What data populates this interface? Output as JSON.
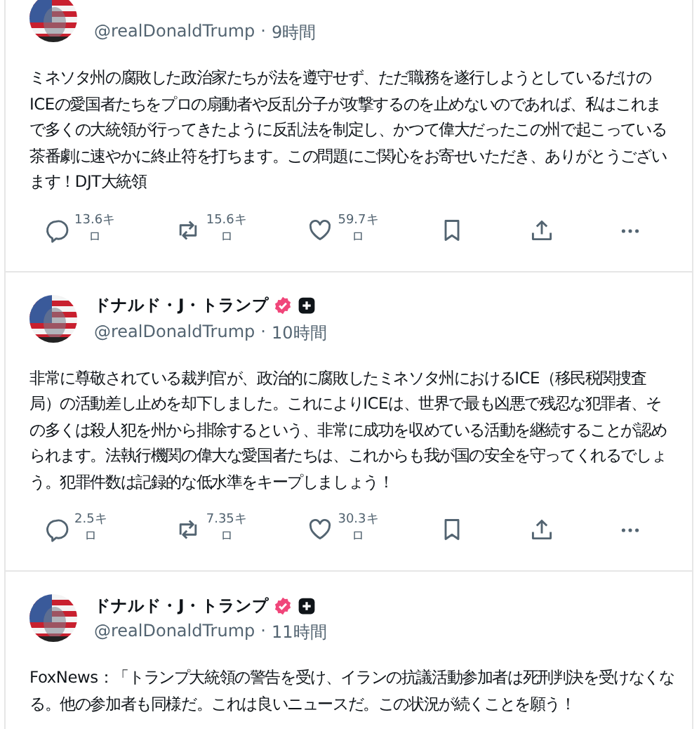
{
  "posts": [
    {
      "handle": "@realDonaldTrump",
      "separator": "·",
      "time": "9時間",
      "body": "ミネソタ州の腐敗した政治家たちが法を遵守せず、ただ職務を遂行しようとしているだけのICEの愛国者たちをプロの扇動者や反乱分子が攻撃するのを止めないのであれば、私はこれまで多くの大統領が行ってきたように反乱法を制定し、かつて偉大だったこの州で起こっている茶番劇に速やかに終止符を打ちます。この問題にご関心をお寄せいただき、ありがとうございます！DJT大統領",
      "replies": "13.6キロ",
      "reposts": "15.6キロ",
      "likes": "59.7キロ"
    },
    {
      "name": "ドナルド・J・トランプ",
      "verified": true,
      "subscribed": true,
      "handle": "@realDonaldTrump",
      "separator": "·",
      "time": "10時間",
      "body": "非常に尊敬されている裁判官が、政治的に腐敗したミネソタ州におけるICE（移民税関捜査局）の活動差し止めを却下しました。これによりICEは、世界で最も凶悪で残忍な犯罪者、その多くは殺人犯を州から排除するという、非常に成功を収めている活動を継続することが認められます。法執行機関の偉大な愛国者たちは、これからも我が国の安全を守ってくれるでしょう。犯罪件数は記録的な低水準をキープしましょう！",
      "replies": "2.5キロ",
      "reposts": "7.35キロ",
      "likes": "30.3キロ"
    },
    {
      "name": "ドナルド・J・トランプ",
      "verified": true,
      "subscribed": true,
      "handle": "@realDonaldTrump",
      "separator": "·",
      "time": "11時間",
      "body": "FoxNews：「トランプ大統領の警告を受け、イランの抗議活動参加者は死刑判決を受けなくなる。他の参加者も同様だ。これは良いニュースだ。この状況が続くことを願う！"
    }
  ]
}
